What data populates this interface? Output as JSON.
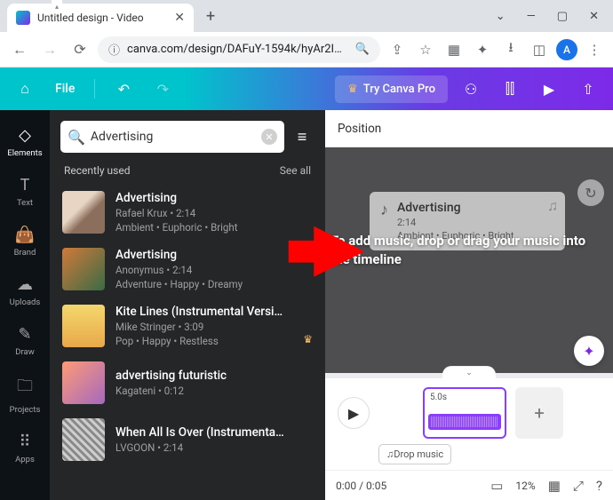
{
  "browser": {
    "tab_title": "Untitled design - Video",
    "url": "canva.com/design/DAFuY-1594k/hyAr2I…",
    "avatar_letter": "A"
  },
  "toolbar": {
    "file_label": "File",
    "try_pro": "Try Canva Pro"
  },
  "rail": {
    "items": [
      {
        "label": "Elements",
        "icon": "△○□"
      },
      {
        "label": "Text",
        "icon": "T"
      },
      {
        "label": "Brand",
        "icon": "⌂"
      },
      {
        "label": "Uploads",
        "icon": "☁"
      },
      {
        "label": "Draw",
        "icon": "✎"
      },
      {
        "label": "Projects",
        "icon": "▭"
      },
      {
        "label": "Apps",
        "icon": "⠿"
      }
    ]
  },
  "panel": {
    "search_value": "Advertising",
    "section": "Recently used",
    "see_all": "See all",
    "tracks": [
      {
        "title": "Advertising",
        "artist": "Rafael Krux",
        "duration": "2:14",
        "tags": "Ambient • Euphoric • Bright",
        "pro": false
      },
      {
        "title": "Advertising",
        "artist": "Anonymus",
        "duration": "2:14",
        "tags": "Adventure • Happy • Dreamy",
        "pro": false
      },
      {
        "title": "Kite Lines (Instrumental Versi…",
        "artist": "Mike Stringer",
        "duration": "3:09",
        "tags": "Pop • Happy • Restless",
        "pro": true
      },
      {
        "title": "advertising futuristic",
        "artist": "Kagateni",
        "duration": "0:12",
        "tags": "",
        "pro": false
      },
      {
        "title": "When All Is Over (Instrumenta…",
        "artist": "LVGOON",
        "duration": "2:14",
        "tags": "",
        "pro": false
      }
    ]
  },
  "canvas": {
    "position_label": "Position",
    "drag_card": {
      "title": "Advertising",
      "meta1": "2:14",
      "meta2": "Ambient • Euphoric • Bright"
    },
    "overlay": "To add music, drop or drag your music into the timeline",
    "clip_duration": "5.0s",
    "drop_music": "♫Drop music"
  },
  "footer": {
    "time": "0:00 / 0:05",
    "zoom": "12%"
  }
}
